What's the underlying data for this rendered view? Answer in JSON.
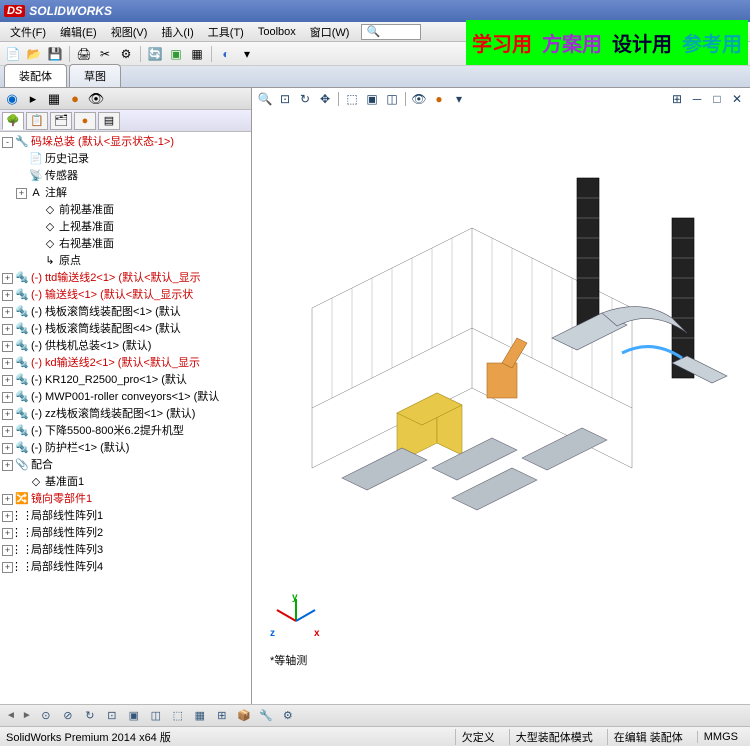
{
  "title": "SOLIDWORKS",
  "watermark": [
    "学习用",
    "方案用",
    "设计用",
    "参考用"
  ],
  "menu": [
    "文件(F)",
    "编辑(E)",
    "视图(V)",
    "插入(I)",
    "工具(T)",
    "Toolbox",
    "窗口(W)"
  ],
  "search_placeholder": "🔍",
  "help_icons": [
    "?",
    "▾"
  ],
  "tabs": [
    {
      "label": "装配体",
      "active": true
    },
    {
      "label": "草图",
      "active": false
    }
  ],
  "tree": [
    {
      "exp": "-",
      "ico": "🔧",
      "cls": "red",
      "text": "码垛总装   (默认<显示状态-1>)",
      "ind": 0
    },
    {
      "exp": "",
      "ico": "📄",
      "cls": "",
      "text": "历史记录",
      "ind": 1
    },
    {
      "exp": "",
      "ico": "📡",
      "cls": "",
      "text": "传感器",
      "ind": 1
    },
    {
      "exp": "+",
      "ico": "A",
      "cls": "",
      "text": "注解",
      "ind": 1
    },
    {
      "exp": "",
      "ico": "◇",
      "cls": "",
      "text": "前视基准面",
      "ind": 2
    },
    {
      "exp": "",
      "ico": "◇",
      "cls": "",
      "text": "上视基准面",
      "ind": 2
    },
    {
      "exp": "",
      "ico": "◇",
      "cls": "",
      "text": "右视基准面",
      "ind": 2
    },
    {
      "exp": "",
      "ico": "↳",
      "cls": "",
      "text": "原点",
      "ind": 2
    },
    {
      "exp": "+",
      "ico": "🔩",
      "cls": "red",
      "text": "(-) ttd输送线2<1> (默认<默认_显示",
      "ind": 0
    },
    {
      "exp": "+",
      "ico": "🔩",
      "cls": "red",
      "text": "(-) 输送线<1> (默认<默认_显示状",
      "ind": 0
    },
    {
      "exp": "+",
      "ico": "🔩",
      "cls": "",
      "text": "(-) 栈板滚筒线装配图<1> (默认",
      "ind": 0
    },
    {
      "exp": "+",
      "ico": "🔩",
      "cls": "",
      "text": "(-) 栈板滚筒线装配图<4> (默认",
      "ind": 0
    },
    {
      "exp": "+",
      "ico": "🔩",
      "cls": "",
      "text": "(-) 供栈机总装<1> (默认)",
      "ind": 0
    },
    {
      "exp": "+",
      "ico": "🔩",
      "cls": "red",
      "text": "(-) kd输送线2<1> (默认<默认_显示",
      "ind": 0
    },
    {
      "exp": "+",
      "ico": "🔩",
      "cls": "",
      "text": "(-) KR120_R2500_pro<1> (默认",
      "ind": 0
    },
    {
      "exp": "+",
      "ico": "🔩",
      "cls": "",
      "text": "(-) MWP001-roller conveyors<1> (默认",
      "ind": 0
    },
    {
      "exp": "+",
      "ico": "🔩",
      "cls": "",
      "text": "(-) zz栈板滚筒线装配图<1> (默认)",
      "ind": 0
    },
    {
      "exp": "+",
      "ico": "🔩",
      "cls": "",
      "text": "(-) 下降5500-800米6.2提升机型",
      "ind": 0
    },
    {
      "exp": "+",
      "ico": "🔩",
      "cls": "",
      "text": "(-) 防护栏<1> (默认)",
      "ind": 0
    },
    {
      "exp": "+",
      "ico": "📎",
      "cls": "",
      "text": "配合",
      "ind": 0
    },
    {
      "exp": "",
      "ico": "◇",
      "cls": "",
      "text": "基准面1",
      "ind": 1
    },
    {
      "exp": "+",
      "ico": "🔀",
      "cls": "red",
      "text": "镜向零部件1",
      "ind": 0
    },
    {
      "exp": "+",
      "ico": "⋮⋮",
      "cls": "",
      "text": "局部线性阵列1",
      "ind": 0
    },
    {
      "exp": "+",
      "ico": "⋮⋮",
      "cls": "",
      "text": "局部线性阵列2",
      "ind": 0
    },
    {
      "exp": "+",
      "ico": "⋮⋮",
      "cls": "",
      "text": "局部线性阵列3",
      "ind": 0
    },
    {
      "exp": "+",
      "ico": "⋮⋮",
      "cls": "",
      "text": "局部线性阵列4",
      "ind": 0
    }
  ],
  "triad": {
    "x": "x",
    "y": "y",
    "z": "z"
  },
  "view_label": "*等轴测",
  "status": {
    "left": "SolidWorks Premium 2014 x64 版",
    "cells": [
      "欠定义",
      "大型装配体模式",
      "在编辑 装配体",
      "",
      "MMGS",
      "",
      ""
    ]
  }
}
